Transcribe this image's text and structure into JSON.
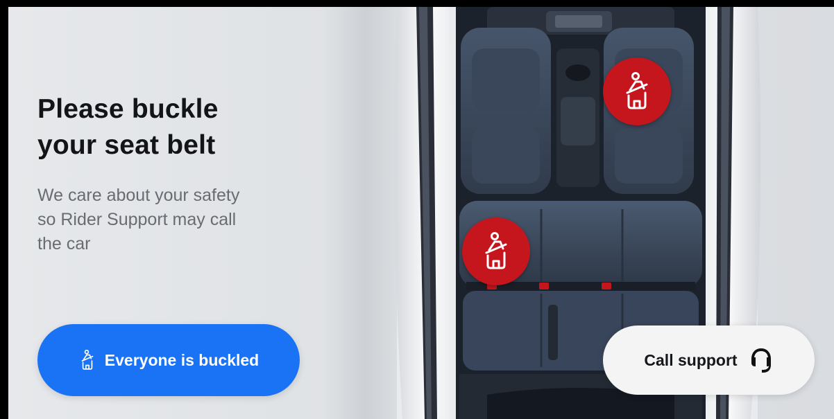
{
  "prompt": {
    "title_line1": "Please buckle",
    "title_line2": "your seat belt",
    "subtitle_line1": "We care about your safety",
    "subtitle_line2": "so Rider Support may call",
    "subtitle_line3": "the car"
  },
  "actions": {
    "buckled_label": "Everyone is buckled",
    "buckled_icon": "seatbelt-icon",
    "support_label": "Call support",
    "support_icon": "headset-icon"
  },
  "seats": [
    {
      "position": "front-right",
      "status": "unbuckled",
      "icon": "seatbelt-alert-icon"
    },
    {
      "position": "rear-left",
      "status": "unbuckled",
      "icon": "seatbelt-alert-icon"
    }
  ],
  "colors": {
    "primary": "#1a73f5",
    "alert": "#c4161c",
    "background": "#e3e5e8",
    "title_text": "#121417",
    "subtitle_text": "#686c72"
  }
}
